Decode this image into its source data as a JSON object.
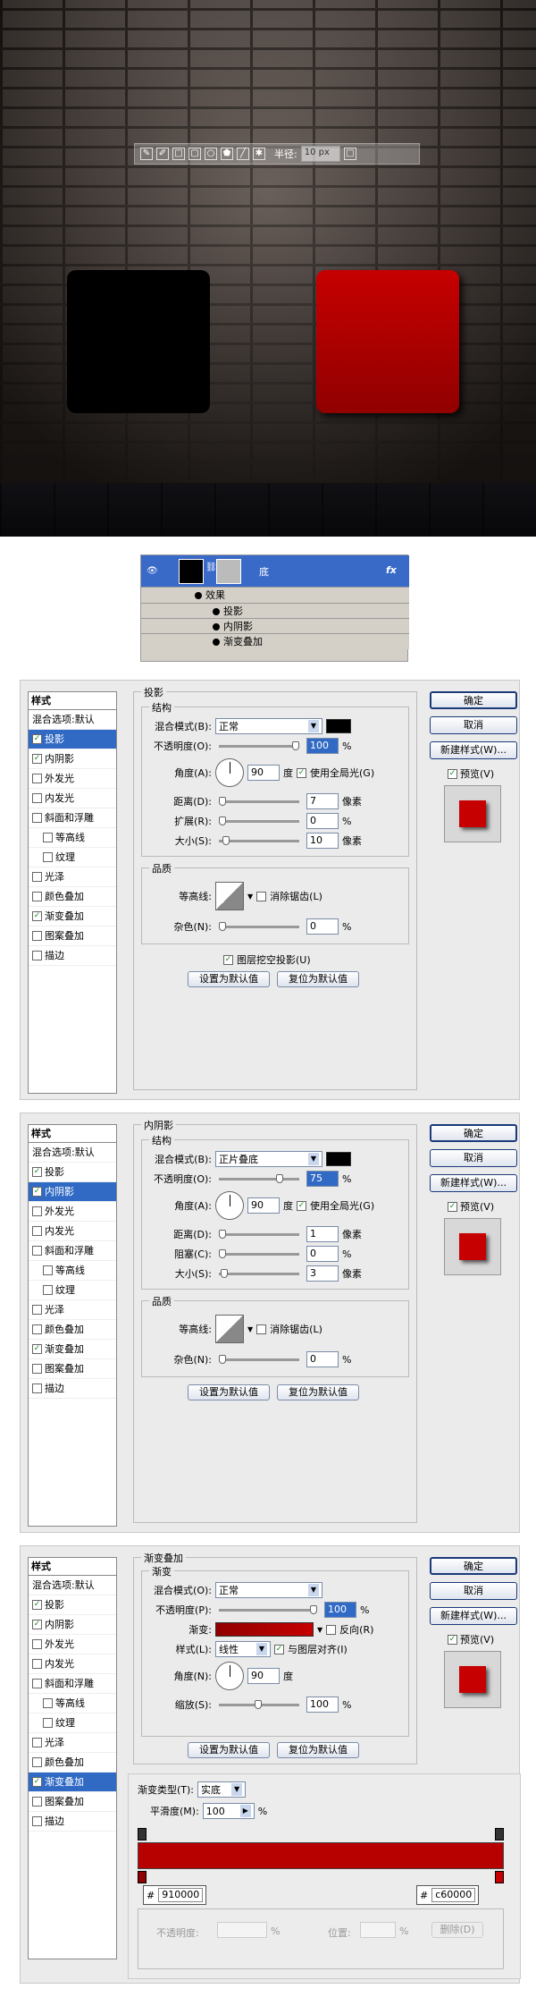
{
  "colors": {
    "red_light": "#c60000",
    "red_dark": "#910000",
    "accent": "#316ac5"
  },
  "toolbar": {
    "radius_label": "半径:",
    "radius_value": "10 px"
  },
  "layers": {
    "layer_name": "底",
    "effects_label": "效果",
    "effects": [
      "投影",
      "内阴影",
      "渐变叠加"
    ]
  },
  "dialogs": {
    "common": {
      "style_header": "样式",
      "blend_default": "混合选项:默认",
      "ok": "确定",
      "cancel": "取消",
      "new_style": "新建样式(W)...",
      "preview": "预览(V)",
      "style_items": [
        "投影",
        "内阴影",
        "外发光",
        "内发光",
        "斜面和浮雕",
        "等高线",
        "纹理",
        "光泽",
        "颜色叠加",
        "渐变叠加",
        "图案叠加",
        "描边"
      ],
      "set_default": "设置为默认值",
      "reset_default": "复位为默认值"
    },
    "drop_shadow": {
      "title": "投影",
      "structure": "结构",
      "blend_label": "混合模式(B):",
      "blend_value": "正常",
      "opacity_label": "不透明度(O):",
      "opacity_value": "100",
      "angle_label": "角度(A):",
      "angle_value": "90",
      "angle_unit": "度",
      "global_light": "使用全局光(G)",
      "distance_label": "距离(D):",
      "distance_value": "7",
      "spread_label": "扩展(R):",
      "spread_value": "0",
      "size_label": "大小(S):",
      "size_value": "10",
      "quality": "品质",
      "contour_label": "等高线:",
      "anti_alias": "消除锯齿(L)",
      "noise_label": "杂色(N):",
      "noise_value": "0",
      "knockout": "图层挖空投影(U)",
      "px": "像素",
      "pct": "%"
    },
    "inner_shadow": {
      "title": "内阴影",
      "structure": "结构",
      "blend_label": "混合模式(B):",
      "blend_value": "正片叠底",
      "opacity_label": "不透明度(O):",
      "opacity_value": "75",
      "angle_label": "角度(A):",
      "angle_value": "90",
      "angle_unit": "度",
      "global_light": "使用全局光(G)",
      "distance_label": "距离(D):",
      "distance_value": "1",
      "choke_label": "阻塞(C):",
      "choke_value": "0",
      "size_label": "大小(S):",
      "size_value": "3",
      "quality": "品质",
      "contour_label": "等高线:",
      "anti_alias": "消除锯齿(L)",
      "noise_label": "杂色(N):",
      "noise_value": "0",
      "px": "像素",
      "pct": "%"
    },
    "gradient_overlay": {
      "title": "渐变叠加",
      "section": "渐变",
      "blend_label": "混合模式(O):",
      "blend_value": "正常",
      "opacity_label": "不透明度(P):",
      "opacity_value": "100",
      "gradient_label": "渐变:",
      "reverse": "反向(R)",
      "style_label": "样式(L):",
      "style_value": "线性",
      "align_layer": "与图层对齐(I)",
      "angle_label": "角度(N):",
      "angle_value": "90",
      "angle_unit": "度",
      "scale_label": "缩放(S):",
      "scale_value": "100",
      "pct": "%",
      "gradient_type_label": "渐变类型(T):",
      "gradient_type_value": "实底",
      "smoothness_label": "平滑度(M):",
      "smoothness_value": "100",
      "stop_left": "910000",
      "stop_right": "c60000",
      "hash": "#",
      "stop_opacity_label": "不透明度:",
      "stop_position_label": "位置:",
      "delete_label": "删除(D)"
    }
  }
}
